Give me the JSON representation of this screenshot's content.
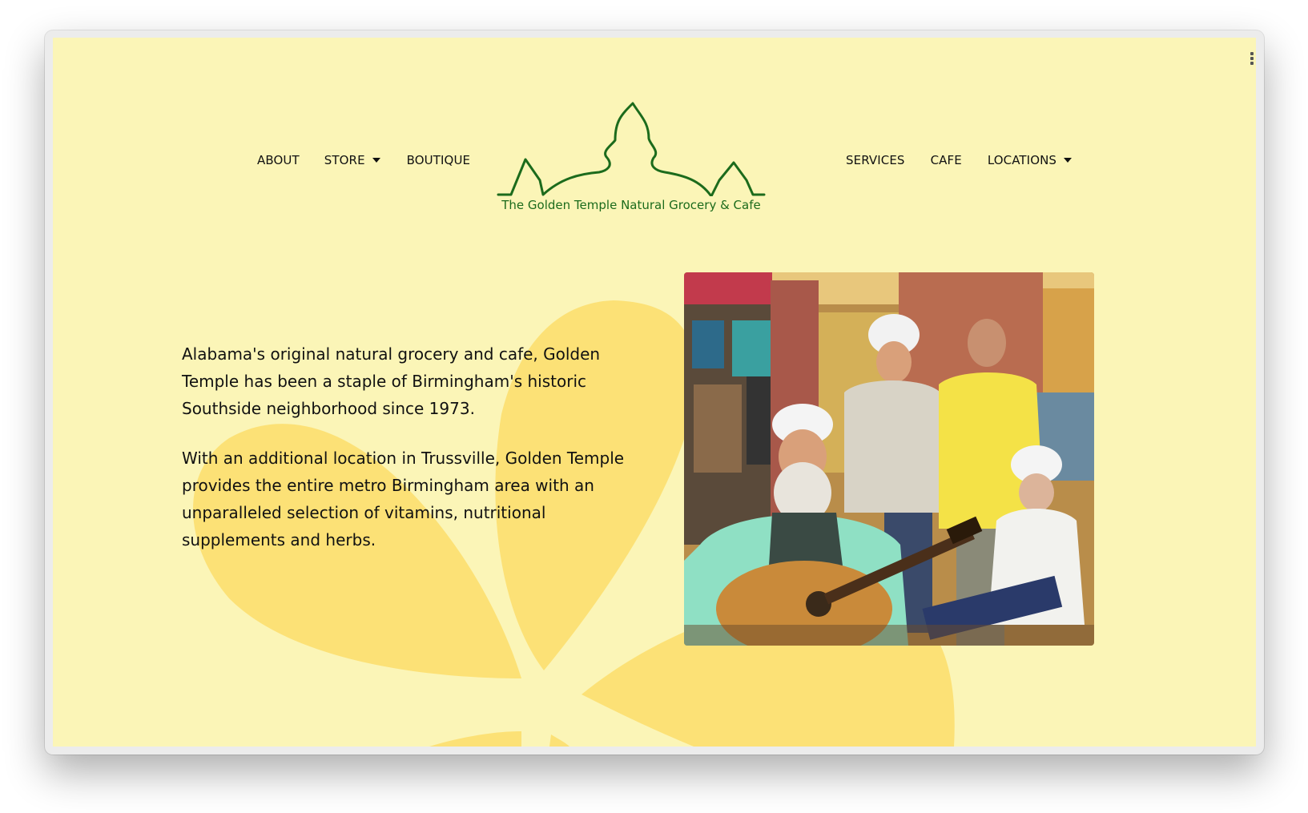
{
  "nav": {
    "left": [
      {
        "label": "ABOUT"
      },
      {
        "label": "STORE",
        "dropdown": true
      },
      {
        "label": "BOUTIQUE"
      }
    ],
    "right": [
      {
        "label": "SERVICES"
      },
      {
        "label": "CAFE"
      },
      {
        "label": "LOCATIONS",
        "dropdown": true
      }
    ]
  },
  "logo": {
    "text": "The Golden Temple Natural Grocery & Cafe",
    "color": "#1c6b1c"
  },
  "intro": {
    "paragraph1": "Alabama's original natural grocery and cafe, Golden Temple has been a staple of Birmingham's historic Southside neighborhood since 1973.",
    "paragraph2": "With an additional location in Trussville, Golden Temple provides the entire metro Birmingham area with an unparalleled selection of vitamins, nutritional supplements and herbs."
  },
  "colors": {
    "page_background": "#fbf5b7",
    "petal": "#fce176",
    "logo_green": "#1c6b1c"
  },
  "photo": {
    "icon": "staff-photo"
  }
}
